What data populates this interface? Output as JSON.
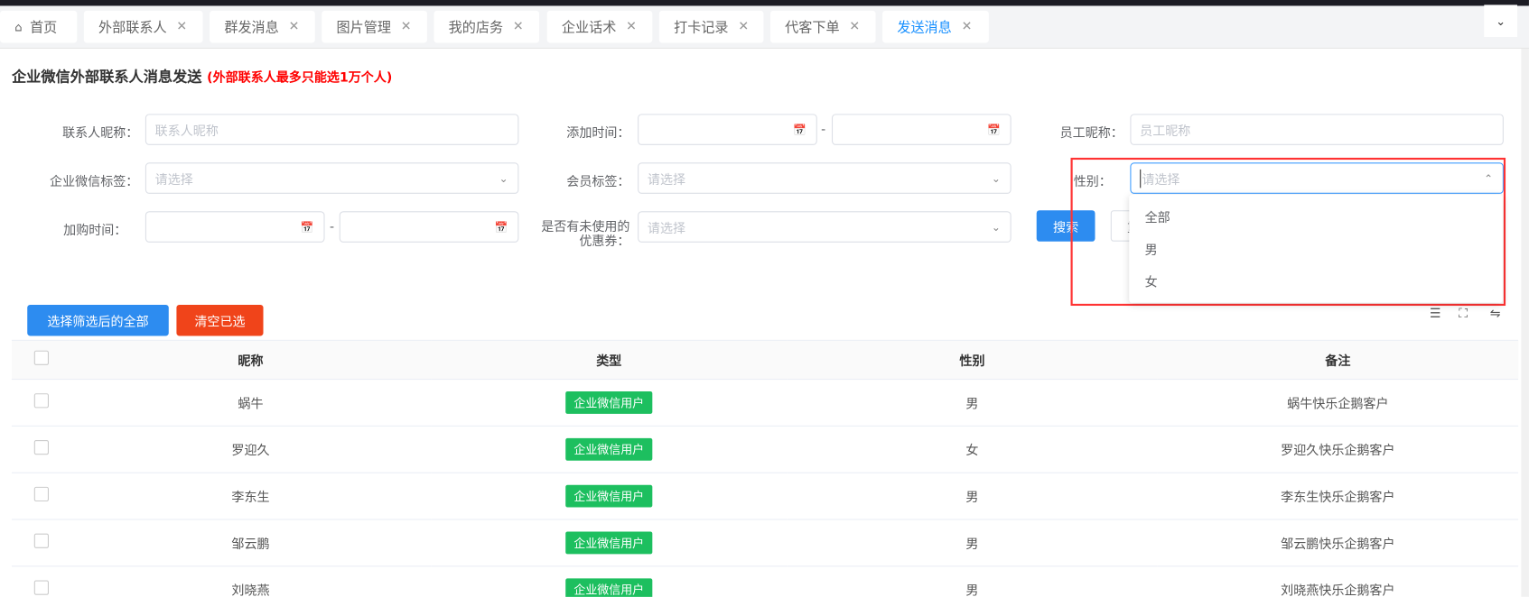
{
  "tabs": [
    {
      "label": "首页",
      "home": true
    },
    {
      "label": "外部联系人"
    },
    {
      "label": "群发消息"
    },
    {
      "label": "图片管理"
    },
    {
      "label": "我的店务"
    },
    {
      "label": "企业话术"
    },
    {
      "label": "打卡记录"
    },
    {
      "label": "代客下单"
    },
    {
      "label": "发送消息",
      "active": true
    }
  ],
  "title": "企业微信外部联系人消息发送",
  "title_warning": "(外部联系人最多只能选1万个人)",
  "form": {
    "contact_nick_label": "联系人昵称：",
    "contact_nick_placeholder": "联系人昵称",
    "add_time_label": "添加时间：",
    "dash": "-",
    "staff_nick_label": "员工昵称：",
    "staff_nick_placeholder": "员工昵称",
    "wecom_tag_label": "企业微信标签：",
    "select_placeholder": "请选择",
    "member_tag_label": "会员标签：",
    "gender_label": "性别：",
    "cart_time_label": "加购时间：",
    "coupon_label_1": "是否有未使用的",
    "coupon_label_2": "优惠券：",
    "search": "搜索",
    "reset": "重置"
  },
  "gender_options": [
    "全部",
    "男",
    "女"
  ],
  "actions": {
    "select_all": "选择筛选后的全部",
    "clear": "清空已选"
  },
  "table": {
    "headers": [
      "昵称",
      "类型",
      "性别",
      "备注"
    ],
    "rows": [
      {
        "nick": "蜗牛",
        "type": "企业微信用户",
        "gender": "男",
        "note": "蜗牛快乐企鹅客户"
      },
      {
        "nick": "罗迎久",
        "type": "企业微信用户",
        "gender": "女",
        "note": "罗迎久快乐企鹅客户"
      },
      {
        "nick": "李东生",
        "type": "企业微信用户",
        "gender": "男",
        "note": "李东生快乐企鹅客户"
      },
      {
        "nick": "邹云鹏",
        "type": "企业微信用户",
        "gender": "男",
        "note": "邹云鹏快乐企鹅客户"
      },
      {
        "nick": "刘晓燕",
        "type": "企业微信用户",
        "gender": "男",
        "note": "刘晓燕快乐企鹅客户"
      }
    ]
  }
}
